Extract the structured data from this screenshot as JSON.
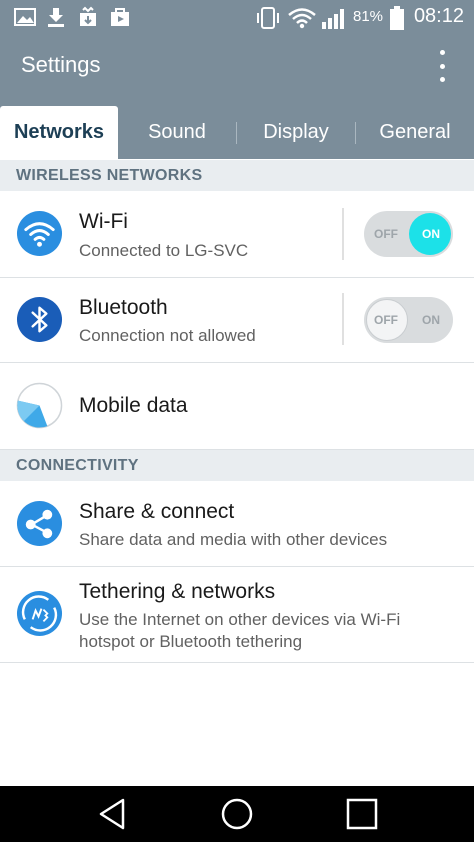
{
  "status_bar": {
    "battery_percent": "81%",
    "time": "08:12",
    "icons": [
      "gallery-icon",
      "download-icon",
      "store-icon",
      "play-store-icon",
      "vibrate-icon",
      "wifi-icon",
      "signal-icon",
      "battery-icon"
    ]
  },
  "app_bar": {
    "title": "Settings"
  },
  "tabs": [
    {
      "label": "Networks",
      "active": true
    },
    {
      "label": "Sound",
      "active": false
    },
    {
      "label": "Display",
      "active": false
    },
    {
      "label": "General",
      "active": false
    }
  ],
  "sections": [
    {
      "header": "WIRELESS NETWORKS",
      "items": [
        {
          "title": "Wi-Fi",
          "subtitle": "Connected to LG-SVC",
          "toggle": {
            "off_label": "OFF",
            "on_label": "ON",
            "state": "on"
          }
        },
        {
          "title": "Bluetooth",
          "subtitle": "Connection not allowed",
          "toggle": {
            "off_label": "OFF",
            "on_label": "ON",
            "state": "off"
          }
        },
        {
          "title": "Mobile data"
        }
      ]
    },
    {
      "header": "CONNECTIVITY",
      "items": [
        {
          "title": "Share & connect",
          "subtitle": "Share data and media with other devices"
        },
        {
          "title": "Tethering & networks",
          "subtitle": "Use the Internet on other devices via Wi-Fi hotspot or Bluetooth tethering"
        }
      ]
    }
  ],
  "colors": {
    "header_bg": "#7b8d9a",
    "toggle_on": "#1ce1e8",
    "wifi_icon": "#2a8ee0",
    "bluetooth_icon": "#1a5db8"
  },
  "nav_bar": {
    "buttons": [
      "back-icon",
      "home-icon",
      "recents-icon"
    ]
  }
}
